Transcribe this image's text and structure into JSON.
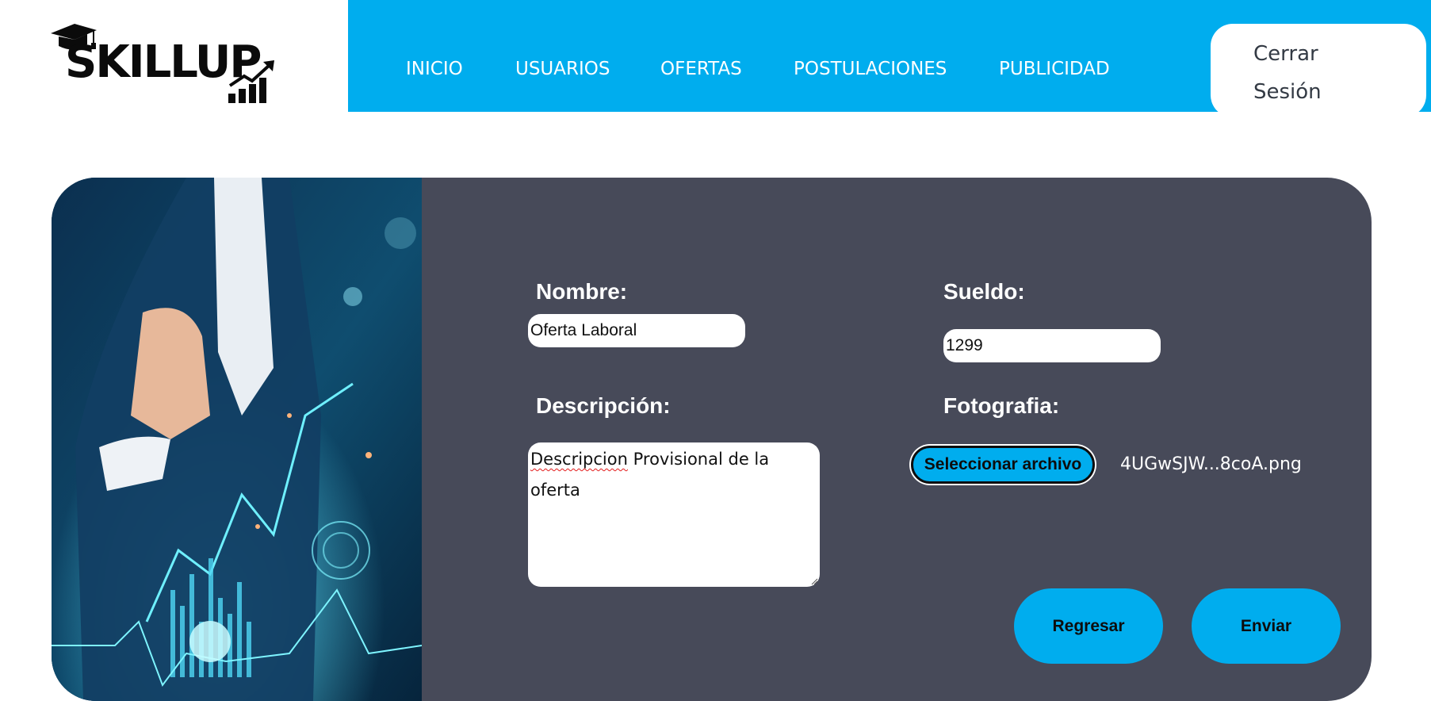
{
  "brand": {
    "logo_text": "SKILLUP"
  },
  "nav": {
    "items": [
      {
        "label": "INICIO"
      },
      {
        "label": "USUARIOS"
      },
      {
        "label": "OFERTAS"
      },
      {
        "label": "POSTULACIONES"
      },
      {
        "label": "PUBLICIDAD"
      }
    ],
    "logout_label": "Cerrar Sesión"
  },
  "form": {
    "nombre_label": "Nombre:",
    "nombre_value": "Oferta Laboral",
    "sueldo_label": "Sueldo:",
    "sueldo_value": "1299",
    "descripcion_label": "Descripción:",
    "descripcion_value_word1": "Descripcion",
    "descripcion_value_rest": " Provisional de la oferta",
    "fotografia_label": "Fotografia:",
    "file_button_label": "Seleccionar archivo",
    "file_name": "4UGwSJW...8coA.png",
    "back_button_label": "Regresar",
    "submit_button_label": "Enviar"
  },
  "colors": {
    "accent": "#00adee",
    "card_background": "#474a59",
    "logout_text": "#333a44",
    "spellcheck_underline": "#e21b1b"
  }
}
